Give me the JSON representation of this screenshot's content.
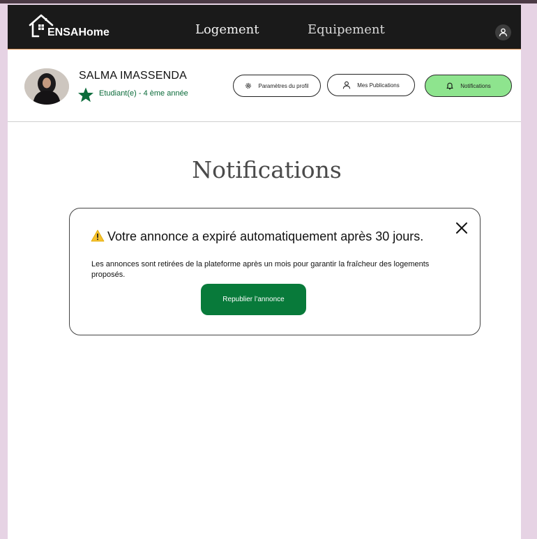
{
  "header": {
    "logo_text": "ENSAHome",
    "nav": [
      {
        "label": "Logement"
      },
      {
        "label": "Equipement"
      }
    ],
    "user_icon": "user-icon"
  },
  "profile": {
    "name": "SALMA IMASSENDA",
    "status": "Etudiant(e) -  4 ème année",
    "badge_icon": "star-icon",
    "badge_color": "#0b6b3a",
    "buttons": {
      "params_label": "Paramètres du profil",
      "pubs_label": "Mes Publications",
      "notifs_label": "Notifications"
    },
    "active_button_color": "#8ee48e"
  },
  "page": {
    "title": "Notifications"
  },
  "notification": {
    "title": "Votre annonce a expiré automatiquement après 30 jours.",
    "body": "Les annonces sont retirées de la plateforme après un mois pour garantir la fraîcheur des logements proposés.",
    "action_label": "Republier l’annonce",
    "action_color": "#087a3a",
    "warning_icon": "warning-icon",
    "close_icon": "close-icon"
  }
}
